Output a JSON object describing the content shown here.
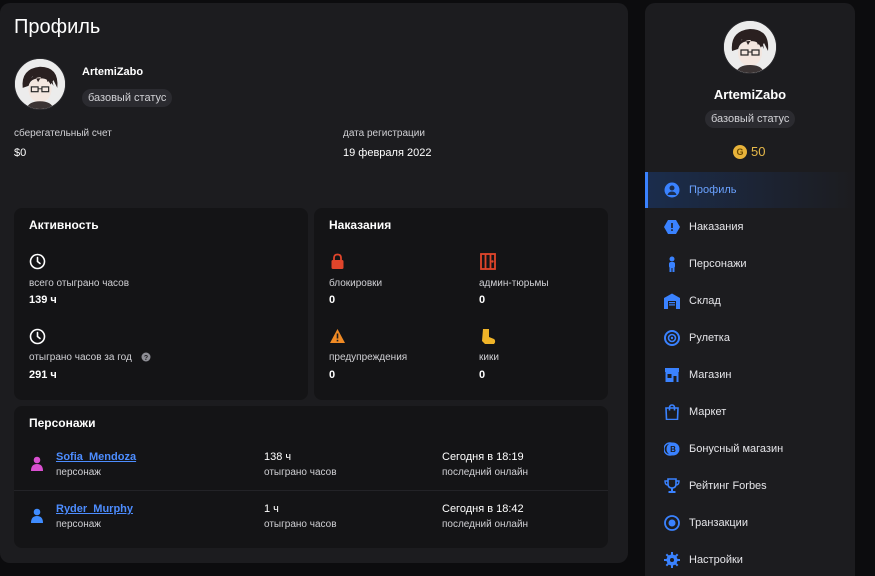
{
  "profile": {
    "title": "Профиль",
    "username": "ArtemiZabo",
    "status": "базовый статус",
    "savings_label": "сберегательный счет",
    "savings_value": "$0",
    "reg_label": "дата регистрации",
    "reg_value": "19 февраля 2022"
  },
  "activity": {
    "title": "Активность",
    "total_label": "всего отыграно часов",
    "total_value": "139 ч",
    "year_label": "отыграно часов за год",
    "year_value": "291 ч"
  },
  "punishments": {
    "title": "Наказания",
    "items": [
      {
        "label": "блокировки",
        "value": "0",
        "icon": "lock-icon"
      },
      {
        "label": "админ-тюрьмы",
        "value": "0",
        "icon": "jail-icon"
      },
      {
        "label": "предупреждения",
        "value": "0",
        "icon": "warning-icon"
      },
      {
        "label": "кики",
        "value": "0",
        "icon": "boot-icon"
      }
    ]
  },
  "characters": {
    "title": "Персонажи",
    "rows": [
      {
        "name": "Sofia_Mendoza",
        "role": "персонаж",
        "hours": "138 ч",
        "hours_label": "отыграно часов",
        "last": "Сегодня в 18:19",
        "last_label": "последний онлайн",
        "color": "#d94fd0"
      },
      {
        "name": "Ryder_Murphy",
        "role": "персонаж",
        "hours": "1 ч",
        "hours_label": "отыграно часов",
        "last": "Сегодня в 18:42",
        "last_label": "последний онлайн",
        "color": "#3f8cff"
      }
    ]
  },
  "sidebar": {
    "username": "ArtemiZabo",
    "status": "базовый статус",
    "coins": "50",
    "coin_symbol": "G",
    "items": [
      {
        "label": "Профиль",
        "icon": "user-icon",
        "active": true
      },
      {
        "label": "Наказания",
        "icon": "shield-alert-icon"
      },
      {
        "label": "Персонажи",
        "icon": "person-icon"
      },
      {
        "label": "Склад",
        "icon": "warehouse-icon"
      },
      {
        "label": "Рулетка",
        "icon": "roulette-icon"
      },
      {
        "label": "Магазин",
        "icon": "shop-icon"
      },
      {
        "label": "Маркет",
        "icon": "bag-icon"
      },
      {
        "label": "Бонусный магазин",
        "icon": "bonus-coin-icon"
      },
      {
        "label": "Рейтинг Forbes",
        "icon": "trophy-icon"
      },
      {
        "label": "Транзакции",
        "icon": "transactions-icon"
      },
      {
        "label": "Настройки",
        "icon": "gear-icon"
      }
    ]
  },
  "colors": {
    "accent": "#3a82ff",
    "danger": "#e0452b",
    "warning": "#f08a24",
    "gold": "#e8b33a"
  }
}
